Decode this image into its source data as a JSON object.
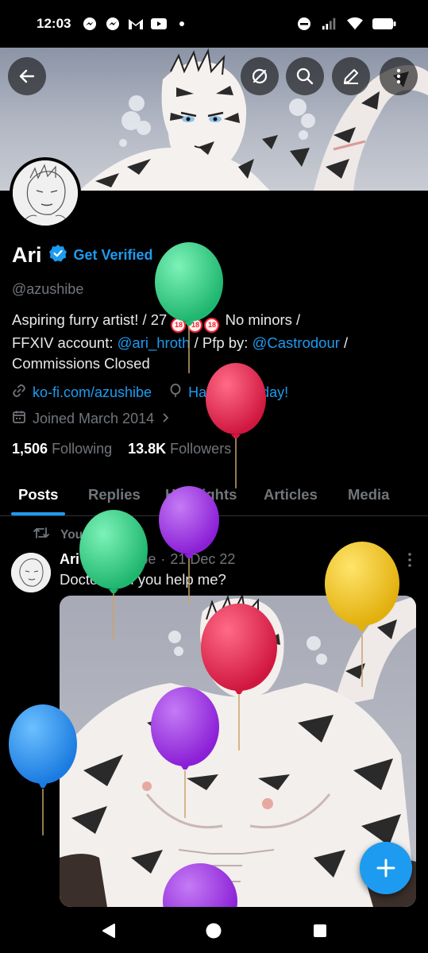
{
  "status_bar": {
    "time": "12:03",
    "notification_icons": [
      "messenger-icon",
      "messenger-icon",
      "gmail-icon",
      "youtube-icon",
      "dot-icon"
    ],
    "system_icons": [
      "do-not-disturb-icon",
      "signal-icon",
      "wifi-icon",
      "battery-icon"
    ]
  },
  "header": {
    "buttons": [
      "back-icon",
      "rocket-slash-icon",
      "search-icon",
      "edit-icon",
      "more-vertical-icon"
    ]
  },
  "profile": {
    "name": "Ari",
    "get_verified": "Get Verified",
    "handle": "@azushibe",
    "bio": {
      "part1": "Aspiring furry artist! / 27 ",
      "age_badge": "18",
      "part2": " No minors /",
      "line2_prefix": "FFXIV account: ",
      "link1": "@ari_hroth",
      "line2_mid": " / Pfp by: ",
      "link2": "@Castrodour",
      "line2_suffix": " /",
      "line3": "Commissions Closed"
    },
    "website": "ko-fi.com/azushibe",
    "birthday": "Happy birthday!",
    "joined": "Joined March 2014",
    "following_count": "1,506",
    "following_label": "Following",
    "followers_count": "13.8K",
    "followers_label": "Followers"
  },
  "tabs": [
    {
      "label": "Posts",
      "active": true
    },
    {
      "label": "Replies",
      "active": false
    },
    {
      "label": "Highlights",
      "active": false
    },
    {
      "label": "Articles",
      "active": false
    },
    {
      "label": "Media",
      "active": false
    }
  ],
  "post": {
    "repost_label": "You reposted",
    "author_name": "Ari",
    "author_handle": "@azushibe",
    "separator": "·",
    "date": "21 Dec 22",
    "text": "Doctor, can you help me?"
  },
  "colors": {
    "accent": "#1d9bf0",
    "background": "#000000",
    "secondary_text": "#71767b",
    "balloon_green": "#2ed184",
    "balloon_red": "#e8234f",
    "balloon_purple": "#9b2fe0",
    "balloon_yellow": "#f1c21b",
    "balloon_blue": "#1f8fff"
  },
  "fab_icon": "plus-icon",
  "nav": [
    "back-triangle-icon",
    "home-circle-icon",
    "recents-square-icon"
  ]
}
